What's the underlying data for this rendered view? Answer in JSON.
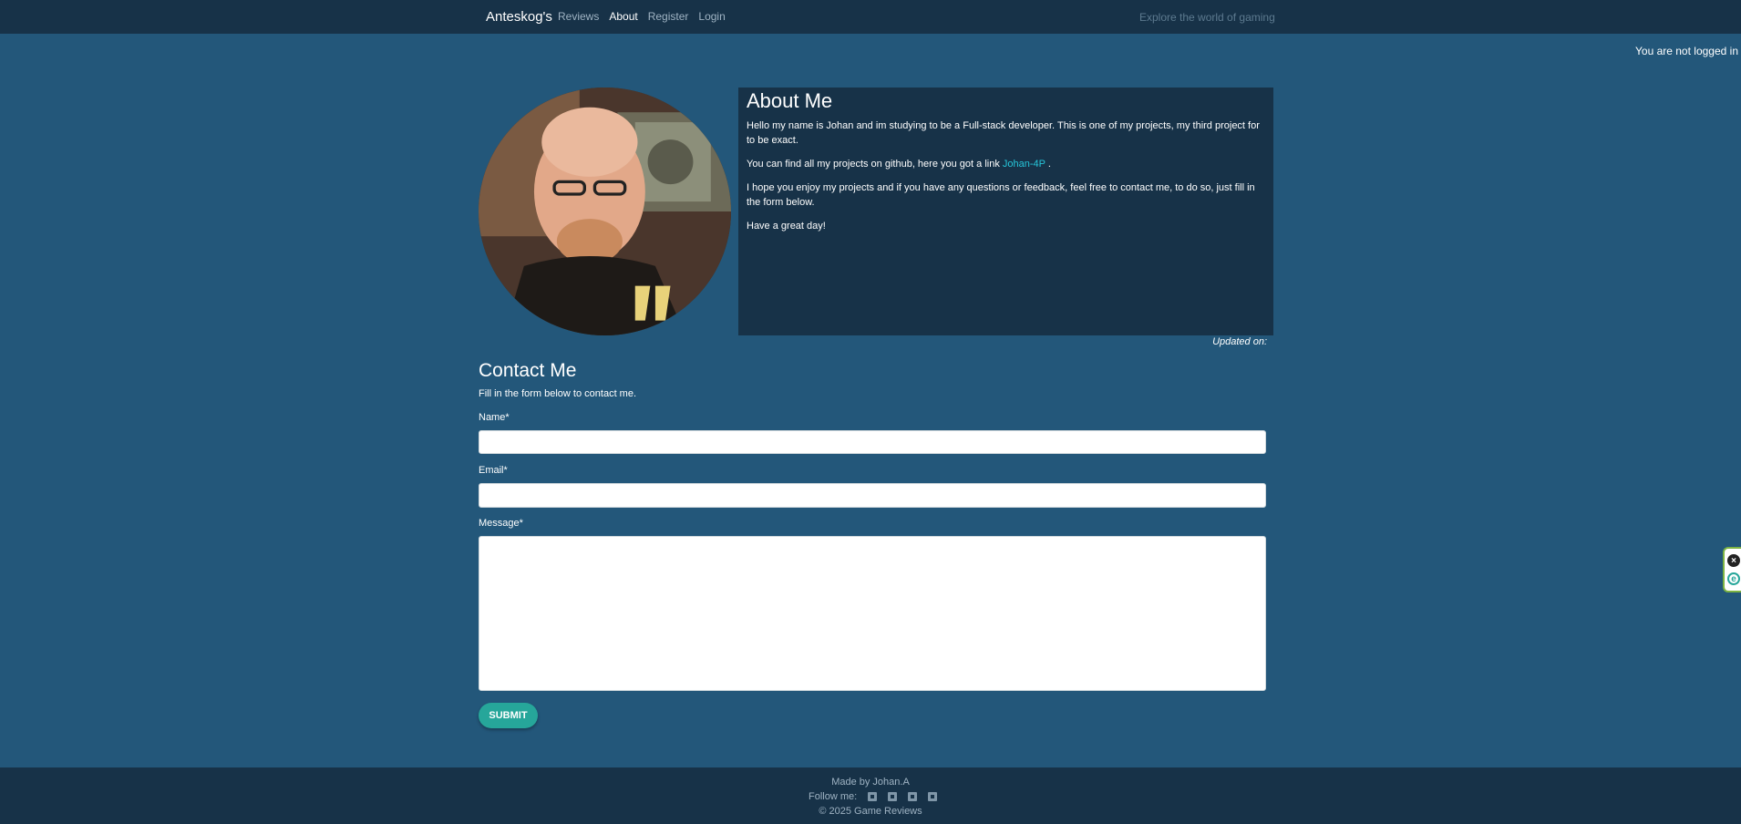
{
  "nav": {
    "brand": "Anteskog's",
    "links": [
      {
        "label": "Reviews",
        "active": false
      },
      {
        "label": "About",
        "active": true
      },
      {
        "label": "Register",
        "active": false
      },
      {
        "label": "Login",
        "active": false
      }
    ],
    "tagline": "Explore the world of gaming"
  },
  "status": {
    "login": "You are not logged in"
  },
  "about": {
    "title": "About Me",
    "p1": "Hello my name is Johan and im studying to be a Full-stack developer. This is one of my projects, my third project for to be exact.",
    "p2_before": "You can find all my projects on github, here you got a link",
    "p2_link": "Johan-4P",
    "p2_after": ".",
    "p3": "I hope you enjoy my projects and if you have any questions or feedback, feel free to contact me, to do so, just fill in the form below.",
    "p4": "Have a great day!",
    "updated": "Updated on:"
  },
  "contact": {
    "title": "Contact Me",
    "subtitle": "Fill in the form below to contact me.",
    "name_label": "Name*",
    "email_label": "Email*",
    "message_label": "Message*",
    "name_value": "",
    "email_value": "",
    "message_value": "",
    "submit_label": "SUBMIT"
  },
  "footer": {
    "made_by": "Made by Johan.A",
    "follow": "Follow me:",
    "social_icons": [
      "facebook-icon",
      "twitter-icon",
      "instagram-icon",
      "youtube-icon"
    ],
    "copyright": "© 2025 Game Reviews"
  },
  "colors": {
    "page_bg": "#23577a",
    "nav_bg": "#173248",
    "accent": "#26a69a",
    "link": "#26c6da"
  }
}
